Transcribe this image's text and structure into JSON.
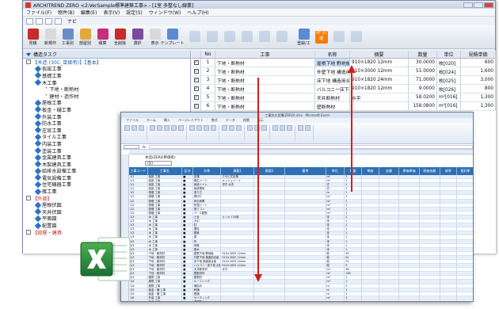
{
  "window": {
    "title": "ARCHITREND ZERO <2:VerSample標準建築工事> - [1室 多整なし線業]"
  },
  "menu": [
    "ファイル(F)",
    "物件(B)",
    "編集(E)",
    "表示(V)",
    "設定(S)",
    "ウィンドウ(W)",
    "ヘルプ(H)"
  ],
  "quick": [
    "ナビ"
  ],
  "toolbar": [
    {
      "label": "見積",
      "color": "#c92a2a"
    },
    {
      "label": "新規作",
      "color": "#d9d9d9"
    },
    {
      "label": "工事別",
      "color": "#6b8cc8"
    },
    {
      "label": "部屋別",
      "color": "#e0a93a"
    },
    {
      "label": "積算",
      "color": "#c62e7b"
    },
    {
      "label": "全削除",
      "color": "#c92a2a"
    },
    {
      "label": "選択",
      "color": "#7b4aa0"
    },
    {
      "label": "表示",
      "color": "#d9d9d9"
    },
    {
      "label": "テンプレート",
      "color": "#5a8bd4"
    },
    {
      "label": "",
      "color": "#8aa6cf",
      "dim": true
    },
    {
      "label": "",
      "color": "#8aa6cf",
      "dim": true
    },
    {
      "label": "",
      "color": "#8aa6cf",
      "dim": true
    },
    {
      "label": "",
      "color": "#8aa6cf",
      "dim": true
    },
    {
      "label": "",
      "color": "#8aa6cf",
      "dim": true
    },
    {
      "label": "",
      "color": "#8aa6cf",
      "dim": true
    },
    {
      "label": "登録/工",
      "color": "#5a8bd4"
    },
    {
      "label": "AT 同期",
      "color": "#ff7a00"
    },
    {
      "label": "",
      "color": "#8aa6cf",
      "dim": true
    },
    {
      "label": "",
      "color": "#8aa6cf",
      "dim": true
    }
  ],
  "tree": {
    "header": "構造タスク",
    "nodes": [
      {
        "label": "【木造 (30C_単価有)】【基本】",
        "level": 0,
        "kind": "top"
      },
      {
        "label": "仮設工事",
        "level": 1
      },
      {
        "label": "基礎工事",
        "level": 1
      },
      {
        "label": "木工事",
        "level": 1
      },
      {
        "label": "下地・断熱材",
        "level": 2,
        "kind": "leaf"
      },
      {
        "label": "建材・造作材",
        "level": 2,
        "kind": "leaf"
      },
      {
        "label": "屋根工事",
        "level": 1
      },
      {
        "label": "板金・樋工事",
        "level": 1
      },
      {
        "label": "外装工事",
        "level": 1
      },
      {
        "label": "防水工事",
        "level": 1
      },
      {
        "label": "左官工事",
        "level": 1
      },
      {
        "label": "タイル工事",
        "level": 1
      },
      {
        "label": "内装工事",
        "level": 1
      },
      {
        "label": "塗装工事",
        "level": 1
      },
      {
        "label": "金属建具工事",
        "level": 1
      },
      {
        "label": "木製建具工事",
        "level": 1
      },
      {
        "label": "給排水設備工事",
        "level": 1
      },
      {
        "label": "電気設備工事",
        "level": 1
      },
      {
        "label": "住宅機器工事",
        "level": 1
      },
      {
        "label": "雑工事",
        "level": 1
      },
      {
        "label": "【外部】",
        "level": 0,
        "kind": "red"
      },
      {
        "label": "屋根伏図",
        "level": 1
      },
      {
        "label": "天井伏図",
        "level": 1
      },
      {
        "label": "平面図",
        "level": 1
      },
      {
        "label": "配置図",
        "level": 1
      },
      {
        "label": "【部屋・建具",
        "level": 0,
        "kind": "red"
      }
    ]
  },
  "grid": {
    "headers": [
      "",
      "No",
      "工事",
      "名称",
      "摘要",
      "数量",
      "単位",
      "見積単価"
    ],
    "rows": [
      {
        "no": "1",
        "work": "下地・断熱材",
        "name": "屋根下地 野地板",
        "spec": "910×1820 12mm",
        "qty": "30.0000",
        "unit": "枚[020]",
        "price": "600"
      },
      {
        "no": "2",
        "work": "下地・断熱材",
        "name": "外壁下地 構造用合板",
        "spec": "910×3000 12mm",
        "qty": "51.0000",
        "unit": "枚[024]",
        "price": "1,600"
      },
      {
        "no": "3",
        "work": "下地・断熱材",
        "name": "床下地 構造用合板",
        "spec": "910×1820 24mm",
        "qty": "71.0000",
        "unit": "枚[025]",
        "price": "3,000"
      },
      {
        "no": "4",
        "work": "下地・断熱材",
        "name": "バルコニー床下地 合板",
        "spec": "910×1820 12mm",
        "qty": "9.0000",
        "unit": "枚[026]",
        "price": "800"
      },
      {
        "no": "5",
        "work": "下地・断熱材",
        "name": "天井断熱材",
        "spec": "水平",
        "qty": "58.0200",
        "unit": "m²[016]",
        "price": "1,300"
      },
      {
        "no": "6",
        "work": "下地・断熱材",
        "name": "壁断熱材",
        "spec": "",
        "qty": "158.0800",
        "unit": "m²[016]",
        "price": "1,300"
      }
    ]
  },
  "excel": {
    "title": "工事別の見積(ZERO).xlsx - Microsoft Excel",
    "tabs": [
      "ファイル",
      "ホーム",
      "挿入",
      "ページレイアウト",
      "数式",
      "データ",
      "校閲",
      "表示"
    ],
    "caption": "木造(ZERO単価有)",
    "combo": "(全)",
    "headers": [
      "工事コード",
      "工事名",
      "区分",
      "名称",
      "摘要1",
      "摘要2",
      "備考",
      "単位",
      "数量",
      "単価",
      "金額",
      "原価単価",
      "原価金額",
      "掛率",
      "粗利率"
    ],
    "rows": [
      [
        "1/1",
        "仮設 工事",
        "■",
        "足場",
        "クサビ式足場",
        "",
        "",
        "m²",
        "1",
        "",
        "",
        "",
        "",
        "",
        ""
      ],
      [
        "1/1",
        "仮設 工事",
        "■",
        "養生シート",
        "メッシュシート",
        "",
        "",
        "m²",
        "1",
        "",
        "",
        "",
        "",
        "",
        ""
      ],
      [
        "1/1",
        "仮設 工事",
        "■",
        "仮設トイレ",
        "洋式 水洗",
        "",
        "",
        "式",
        "1",
        "",
        "",
        "",
        "",
        "",
        ""
      ],
      [
        "1/1",
        "仮設 工事",
        "■",
        "仮設電気",
        "",
        "",
        "",
        "式",
        "1",
        "",
        "",
        "",
        "",
        "",
        ""
      ],
      [
        "1/2",
        "基礎 工事",
        "■",
        "遣り方",
        "",
        "",
        "",
        "m",
        "1",
        "",
        "",
        "",
        "",
        "",
        ""
      ],
      [
        "1/2",
        "基礎 工事",
        "■",
        "根切り",
        "",
        "",
        "",
        "m³",
        "1",
        "",
        "",
        "",
        "",
        "",
        ""
      ],
      [
        "1/2",
        "基礎 工事",
        "■",
        "砕石地業",
        "",
        "",
        "",
        "m²",
        "1",
        "",
        "",
        "",
        "",
        "",
        ""
      ],
      [
        "1/2",
        "基礎 工事",
        "■",
        "防湿シート",
        "",
        "",
        "",
        "m²",
        "1",
        "",
        "",
        "",
        "",
        "",
        ""
      ],
      [
        "1/2",
        "基礎 工事",
        "■",
        "捨てコン",
        "",
        "",
        "",
        "m²",
        "1",
        "",
        "",
        "",
        "",
        "",
        ""
      ],
      [
        "1/2",
        "基礎 工事",
        "■",
        "ベース配筋",
        "",
        "",
        "",
        "m²",
        "1",
        "",
        "",
        "",
        "",
        "",
        ""
      ],
      [
        "1/3",
        "木 工事",
        "■",
        "土台",
        "ヒノキ 120角",
        "",
        "",
        "本",
        "1",
        "",
        "",
        "",
        "",
        "",
        ""
      ],
      [
        "1/3",
        "木 工事",
        "■",
        "大引",
        "",
        "",
        "",
        "本",
        "1",
        "",
        "",
        "",
        "",
        "",
        ""
      ],
      [
        "1/3",
        "木 工事",
        "■",
        "柱",
        "",
        "",
        "",
        "本",
        "1",
        "",
        "",
        "",
        "",
        "",
        ""
      ],
      [
        "1/3",
        "木 工事",
        "■",
        "間柱",
        "",
        "",
        "",
        "本",
        "1",
        "",
        "",
        "",
        "",
        "",
        ""
      ],
      [
        "1/3",
        "木 工事",
        "■",
        "胴差",
        "",
        "",
        "",
        "本",
        "1",
        "",
        "",
        "",
        "",
        "",
        ""
      ],
      [
        "1/3",
        "木 工事",
        "■",
        "梁",
        "",
        "",
        "",
        "本",
        "1",
        "",
        "",
        "",
        "",
        "",
        ""
      ],
      [
        "1/3",
        "木 工事",
        "■",
        "桁",
        "",
        "",
        "",
        "本",
        "1",
        "",
        "",
        "",
        "",
        "",
        ""
      ],
      [
        "1/3",
        "木 工事",
        "■",
        "母屋",
        "",
        "",
        "",
        "本",
        "1",
        "",
        "",
        "",
        "",
        "",
        ""
      ],
      [
        "1/3",
        "木 工事",
        "■",
        "垂木",
        "",
        "",
        "",
        "本",
        "1",
        "",
        "",
        "",
        "",
        "",
        ""
      ],
      [
        "1/3",
        "下地・断熱材",
        "■",
        "屋根下地 野地板",
        "910×1820 12mm",
        "",
        "",
        "枚",
        "30",
        "",
        "",
        "",
        "",
        "",
        ""
      ],
      [
        "1/3",
        "下地・断熱材",
        "■",
        "外壁下地 構造用合板",
        "910×3000 12mm",
        "",
        "",
        "枚",
        "51",
        "",
        "",
        "",
        "",
        "",
        ""
      ],
      [
        "1/3",
        "下地・断熱材",
        "■",
        "床下地 構造用合板",
        "910×1820 24mm",
        "",
        "",
        "枚",
        "71",
        "",
        "",
        "",
        "",
        "",
        ""
      ],
      [
        "1/3",
        "下地・断熱材",
        "■",
        "バルコニー床下地 合板",
        "910×1820 12mm",
        "",
        "",
        "枚",
        "9",
        "",
        "",
        "",
        "",
        "",
        ""
      ],
      [
        "1/3",
        "下地・断熱材",
        "■",
        "天井断熱材",
        "水平",
        "",
        "",
        "m²",
        "58",
        "",
        "",
        "",
        "",
        "",
        ""
      ],
      [
        "1/3",
        "下地・断熱材",
        "■",
        "壁断熱材",
        "",
        "",
        "",
        "m²",
        "158",
        "",
        "",
        "",
        "",
        "",
        ""
      ],
      [
        "1/4",
        "屋根 工事",
        "■",
        "屋根材",
        "",
        "",
        "",
        "m²",
        "1",
        "",
        "",
        "",
        "",
        "",
        ""
      ],
      [
        "1/4",
        "屋根 工事",
        "■",
        "ルーフィング",
        "",
        "",
        "",
        "m²",
        "1",
        "",
        "",
        "",
        "",
        "",
        ""
      ],
      [
        "1/4",
        "屋根 工事",
        "■",
        "棟包み",
        "",
        "",
        "",
        "m",
        "1",
        "",
        "",
        "",
        "",
        "",
        ""
      ],
      [
        "1/5",
        "板金・樋 工事",
        "■",
        "軒樋",
        "",
        "",
        "",
        "m",
        "1",
        "",
        "",
        "",
        "",
        "",
        ""
      ],
      [
        "1/5",
        "板金・樋 工事",
        "■",
        "竪樋",
        "",
        "",
        "",
        "m",
        "1",
        "",
        "",
        "",
        "",
        "",
        ""
      ],
      [
        "1/6",
        "外装 工事",
        "■",
        "サイディング",
        "",
        "",
        "",
        "m²",
        "1",
        "",
        "",
        "",
        "",
        "",
        ""
      ],
      [
        "1/6",
        "外装 工事",
        "■",
        "透湿防水シート",
        "",
        "",
        "",
        "m²",
        "1",
        "",
        "",
        "",
        "",
        "",
        ""
      ]
    ]
  },
  "colors": {
    "arrow": "#d21f1f",
    "excel_header": "#2f6fb3",
    "excel_logo_green": "#1f7a3e"
  }
}
